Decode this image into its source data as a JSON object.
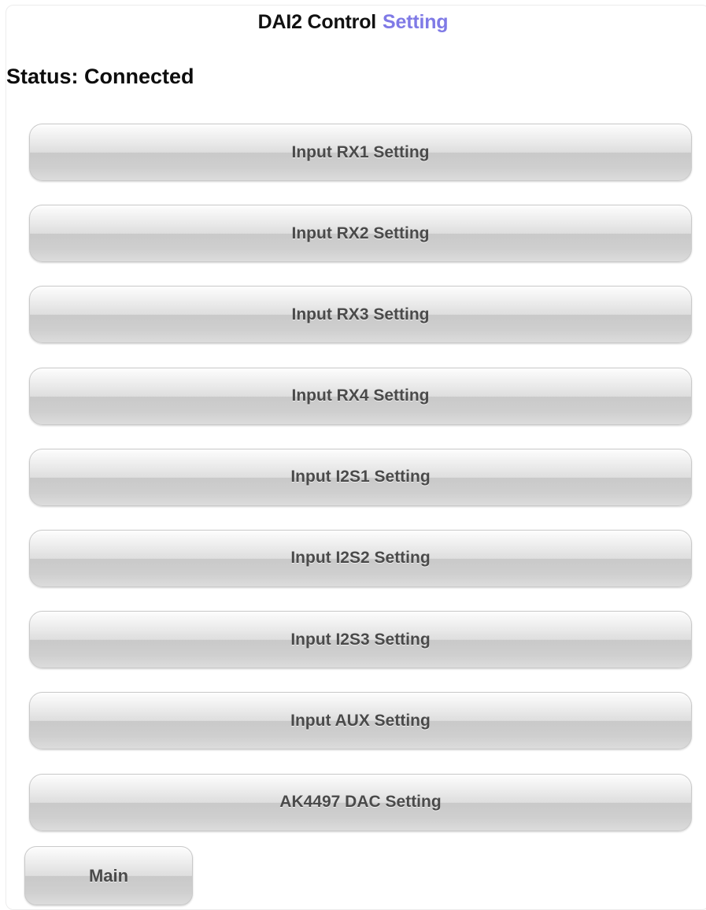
{
  "header": {
    "title": "DAI2 Control",
    "subtitle": "Setting"
  },
  "status": {
    "text": "Status: Connected"
  },
  "buttons": [
    {
      "label": "Input RX1 Setting"
    },
    {
      "label": "Input RX2 Setting"
    },
    {
      "label": "Input RX3 Setting"
    },
    {
      "label": "Input RX4 Setting"
    },
    {
      "label": "Input I2S1 Setting"
    },
    {
      "label": "Input I2S2 Setting"
    },
    {
      "label": "Input I2S3 Setting"
    },
    {
      "label": "Input AUX Setting"
    },
    {
      "label": "AK4497 DAC Setting"
    }
  ],
  "footer": {
    "main_label": "Main"
  }
}
